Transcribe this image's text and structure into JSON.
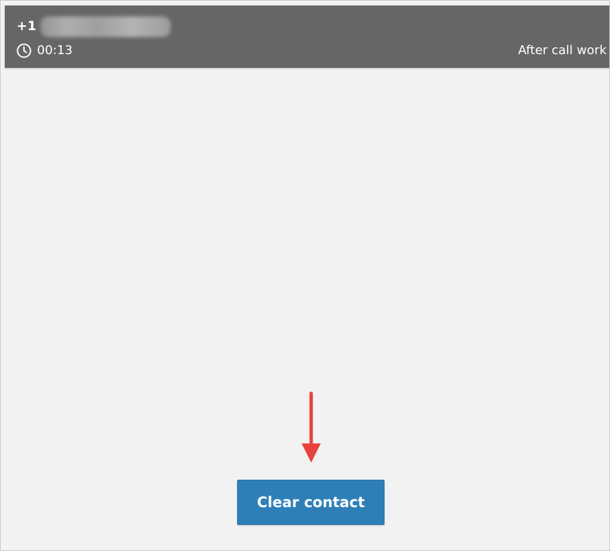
{
  "header": {
    "phone_prefix": "+1",
    "timer": "00:13",
    "state": "After call work",
    "clock_icon": "clock-icon"
  },
  "actions": {
    "clear_contact_label": "Clear contact"
  },
  "annotation": {
    "arrow_icon": "arrow-down-icon",
    "arrow_color": "#e8423f"
  },
  "colors": {
    "header_background": "#666666",
    "body_background": "#f2f2f2",
    "button_background": "#2e7fb8"
  }
}
